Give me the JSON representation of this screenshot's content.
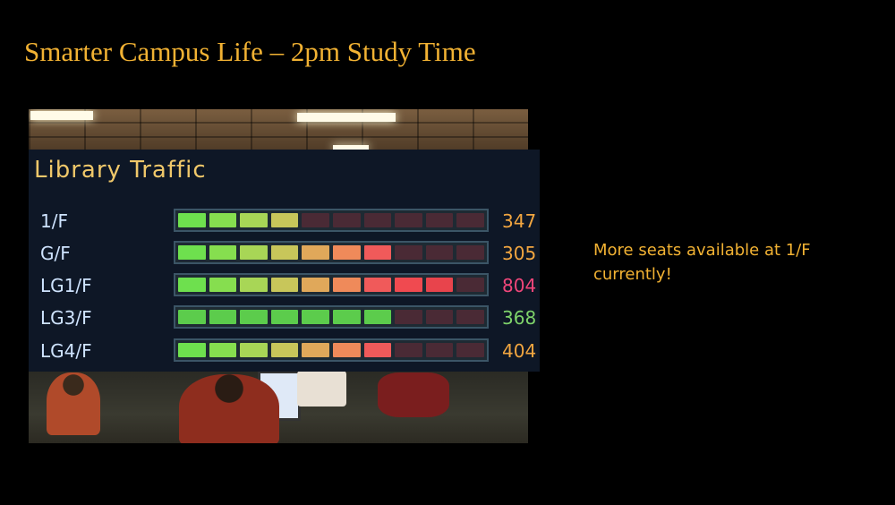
{
  "slide": {
    "title": "Smarter Campus Life – 2pm Study Time",
    "note": "More seats available at 1/F currently!"
  },
  "panel": {
    "title": "Library Traffic",
    "rows": [
      {
        "floor": "1/F",
        "count": "347",
        "count_color": "#f2a640",
        "level": 0.4
      },
      {
        "floor": "G/F",
        "count": "305",
        "count_color": "#f2a640",
        "level": 0.7
      },
      {
        "floor": "LG1/F",
        "count": "804",
        "count_color": "#f0467a",
        "level": 0.9
      },
      {
        "floor": "LG3/F",
        "count": "368",
        "count_color": "#7ed36a",
        "level": 0.7
      },
      {
        "floor": "LG4/F",
        "count": "404",
        "count_color": "#f2a640",
        "level": 0.7
      }
    ],
    "colors": {
      "empty_segment": "#4a2a35",
      "scale": [
        "#6ee04e",
        "#86de4f",
        "#a8d656",
        "#c8c65a",
        "#e0a85a",
        "#ef8a5a",
        "#f05a5a",
        "#f04a50",
        "#e8444c",
        "#d44"
      ]
    }
  }
}
